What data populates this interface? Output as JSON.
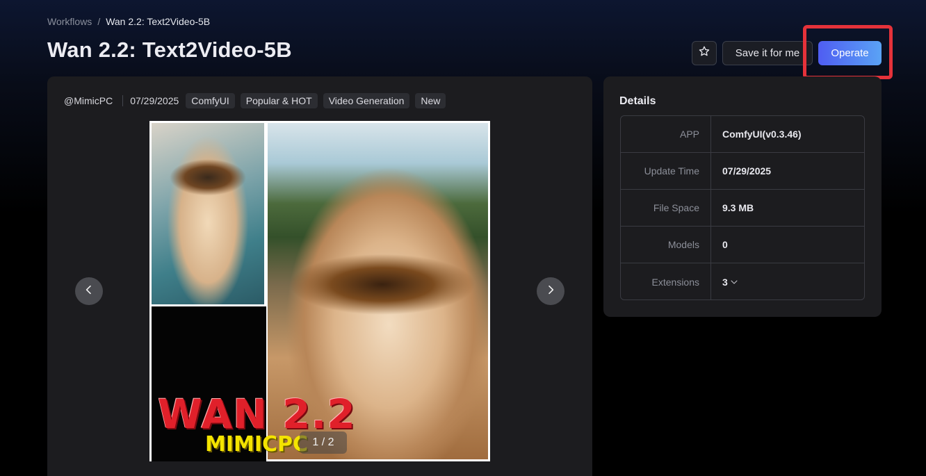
{
  "breadcrumb": {
    "parent": "Workflows",
    "separator": "/",
    "current": "Wan 2.2: Text2Video-5B"
  },
  "page": {
    "title": "Wan 2.2: Text2Video-5B"
  },
  "actions": {
    "favorite_icon": "star-icon",
    "save_label": "Save it for me",
    "operate_label": "Operate"
  },
  "meta": {
    "author": "@MimicPC",
    "date": "07/29/2025",
    "tags": [
      "ComfyUI",
      "Popular & HOT",
      "Video Generation",
      "New"
    ]
  },
  "carousel": {
    "indicator": "1 / 2",
    "prev_icon": "chevron-left-icon",
    "next_icon": "chevron-right-icon"
  },
  "details": {
    "title": "Details",
    "rows": [
      {
        "key": "APP",
        "value": "ComfyUI(v0.3.46)"
      },
      {
        "key": "Update Time",
        "value": "07/29/2025"
      },
      {
        "key": "File Space",
        "value": "9.3 MB"
      },
      {
        "key": "Models",
        "value": "0"
      },
      {
        "key": "Extensions",
        "value": "3"
      }
    ]
  },
  "colors": {
    "accent_start": "#4f5df2",
    "accent_end": "#5aa3f5",
    "highlight": "#e5323a",
    "card_bg": "#1c1c1f"
  }
}
